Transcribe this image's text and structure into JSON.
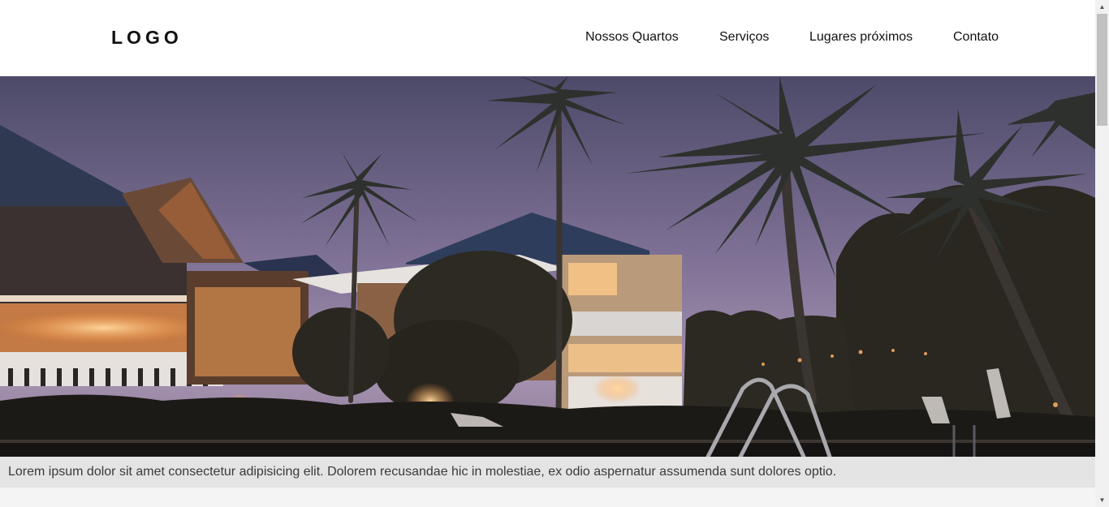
{
  "header": {
    "logo": "LOGO",
    "nav": [
      {
        "label": "Nossos Quartos"
      },
      {
        "label": "Serviços"
      },
      {
        "label": "Lugares próximos"
      },
      {
        "label": "Contato"
      }
    ]
  },
  "hero": {
    "image_icon": "resort-night-photo"
  },
  "caption": {
    "text": "Lorem ipsum dolor sit amet consectetur adipisicing elit. Dolorem recusandae hic in molestiae, ex odio aspernatur assumenda sunt dolores optio."
  },
  "scrollbar": {
    "up_icon": "triangle-up-icon",
    "down_icon": "triangle-down-icon"
  },
  "colors": {
    "header_bg": "#ffffff",
    "caption_bg": "#e4e4e4",
    "page_bg": "#f4f4f4",
    "text": "#111111"
  }
}
